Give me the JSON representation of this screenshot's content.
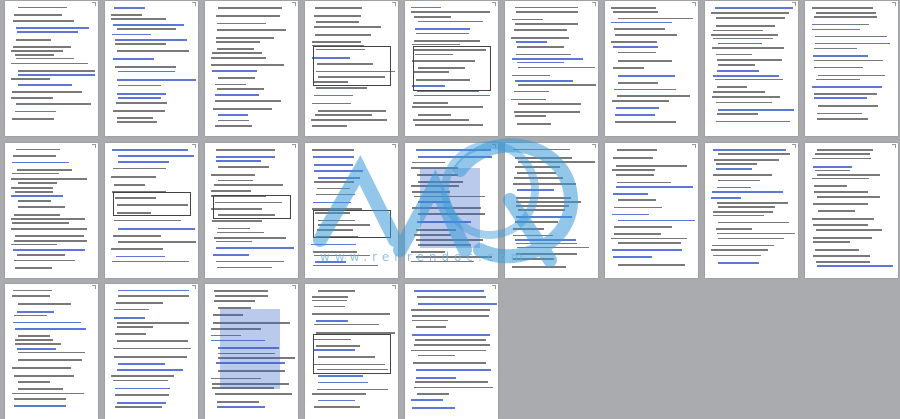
{
  "viewer": {
    "watermark_text": "www.renrendoc.com",
    "watermark_color": "#3a9ad9",
    "page_count": 23
  },
  "pages": [
    {
      "id": 1
    },
    {
      "id": 2
    },
    {
      "id": 3
    },
    {
      "id": 4
    },
    {
      "id": 5
    },
    {
      "id": 6
    },
    {
      "id": 7
    },
    {
      "id": 8
    },
    {
      "id": 9
    },
    {
      "id": 10
    },
    {
      "id": 11
    },
    {
      "id": 12
    },
    {
      "id": 13
    },
    {
      "id": 14
    },
    {
      "id": 15
    },
    {
      "id": 16
    },
    {
      "id": 17
    },
    {
      "id": 18
    },
    {
      "id": 19
    },
    {
      "id": 20
    },
    {
      "id": 21
    },
    {
      "id": 22
    },
    {
      "id": 23
    }
  ]
}
